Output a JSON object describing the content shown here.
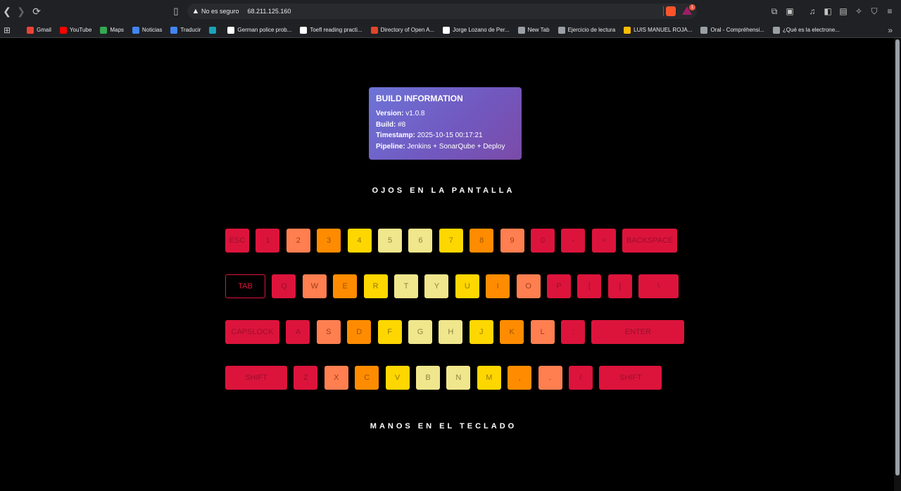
{
  "browser": {
    "insecure_label": "No es seguro",
    "url": "68.211.125.160",
    "rewards_badge": "1",
    "bookmarks": [
      {
        "label": "Gmail",
        "color": "#ea4335"
      },
      {
        "label": "YouTube",
        "color": "#ff0000"
      },
      {
        "label": "Maps",
        "color": "#34a853"
      },
      {
        "label": "Noticias",
        "color": "#4285f4"
      },
      {
        "label": "Traducir",
        "color": "#4285f4"
      },
      {
        "label": "",
        "color": "#1aa3b9"
      },
      {
        "label": "German police prob...",
        "color": "#ffffff"
      },
      {
        "label": "Toefl reading practi...",
        "color": "#ffffff"
      },
      {
        "label": "Directory of Open A...",
        "color": "#e0452b"
      },
      {
        "label": "Jorge Lozano de Per...",
        "color": "#ffffff"
      },
      {
        "label": "New Tab",
        "color": "#9aa0a6"
      },
      {
        "label": "Ejercicio de lectura",
        "color": "#9aa0a6"
      },
      {
        "label": "LUIS MANUEL ROJA...",
        "color": "#fbbc04"
      },
      {
        "label": "Oral - Compréhensi...",
        "color": "#9aa0a6"
      },
      {
        "label": "¿Qué es la electrone...",
        "color": "#9aa0a6"
      }
    ]
  },
  "build": {
    "title": "BUILD INFORMATION",
    "version_label": "Version:",
    "version": "v1.0.8",
    "build_label": "Build:",
    "build": "#8",
    "timestamp_label": "Timestamp:",
    "timestamp": "2025-10-15 00:17:21",
    "pipeline_label": "Pipeline:",
    "pipeline": "Jenkins + SonarQube + Deploy"
  },
  "headings": {
    "top": "OJOS EN LA PANTALLA",
    "bottom": "MANOS EN EL TECLADO"
  },
  "keyboard": {
    "colors": {
      "red": "#dc143c",
      "salmon": "#ff7f50",
      "orange": "#ff8c00",
      "gold": "#ffd700",
      "khaki": "#f0e68c"
    },
    "rows": [
      [
        {
          "label": "ESC",
          "color": "red"
        },
        {
          "label": "1",
          "color": "red"
        },
        {
          "label": "2",
          "color": "salmon"
        },
        {
          "label": "3",
          "color": "orange"
        },
        {
          "label": "4",
          "color": "gold"
        },
        {
          "label": "5",
          "color": "khaki"
        },
        {
          "label": "6",
          "color": "khaki"
        },
        {
          "label": "7",
          "color": "gold"
        },
        {
          "label": "8",
          "color": "orange"
        },
        {
          "label": "9",
          "color": "salmon"
        },
        {
          "label": "0",
          "color": "red"
        },
        {
          "label": "-",
          "color": "red"
        },
        {
          "label": "=",
          "color": "red"
        },
        {
          "label": "BACKSPACE",
          "color": "red"
        }
      ],
      [
        {
          "label": "TAB",
          "color": "outline"
        },
        {
          "label": "Q",
          "color": "red"
        },
        {
          "label": "W",
          "color": "salmon"
        },
        {
          "label": "E",
          "color": "orange"
        },
        {
          "label": "R",
          "color": "gold"
        },
        {
          "label": "T",
          "color": "khaki"
        },
        {
          "label": "Y",
          "color": "khaki"
        },
        {
          "label": "U",
          "color": "gold"
        },
        {
          "label": "I",
          "color": "orange"
        },
        {
          "label": "O",
          "color": "salmon"
        },
        {
          "label": "P",
          "color": "red"
        },
        {
          "label": "[",
          "color": "red"
        },
        {
          "label": "]",
          "color": "red"
        },
        {
          "label": "\\",
          "color": "red"
        }
      ],
      [
        {
          "label": "CAPSLOCK",
          "color": "red"
        },
        {
          "label": "A",
          "color": "red"
        },
        {
          "label": "S",
          "color": "salmon"
        },
        {
          "label": "D",
          "color": "orange"
        },
        {
          "label": "F",
          "color": "gold"
        },
        {
          "label": "G",
          "color": "khaki"
        },
        {
          "label": "H",
          "color": "khaki"
        },
        {
          "label": "J",
          "color": "gold"
        },
        {
          "label": "K",
          "color": "orange"
        },
        {
          "label": "L",
          "color": "salmon"
        },
        {
          "label": ";",
          "color": "red"
        },
        {
          "label": "ENTER",
          "color": "red"
        }
      ],
      [
        {
          "label": "SHIFT",
          "color": "red"
        },
        {
          "label": "Z",
          "color": "red"
        },
        {
          "label": "X",
          "color": "salmon"
        },
        {
          "label": "C",
          "color": "orange"
        },
        {
          "label": "V",
          "color": "gold"
        },
        {
          "label": "B",
          "color": "khaki"
        },
        {
          "label": "N",
          "color": "khaki"
        },
        {
          "label": "M",
          "color": "gold"
        },
        {
          "label": ",",
          "color": "orange"
        },
        {
          "label": ".",
          "color": "salmon"
        },
        {
          "label": "/",
          "color": "red"
        },
        {
          "label": "SHIFT",
          "color": "red"
        }
      ]
    ]
  }
}
